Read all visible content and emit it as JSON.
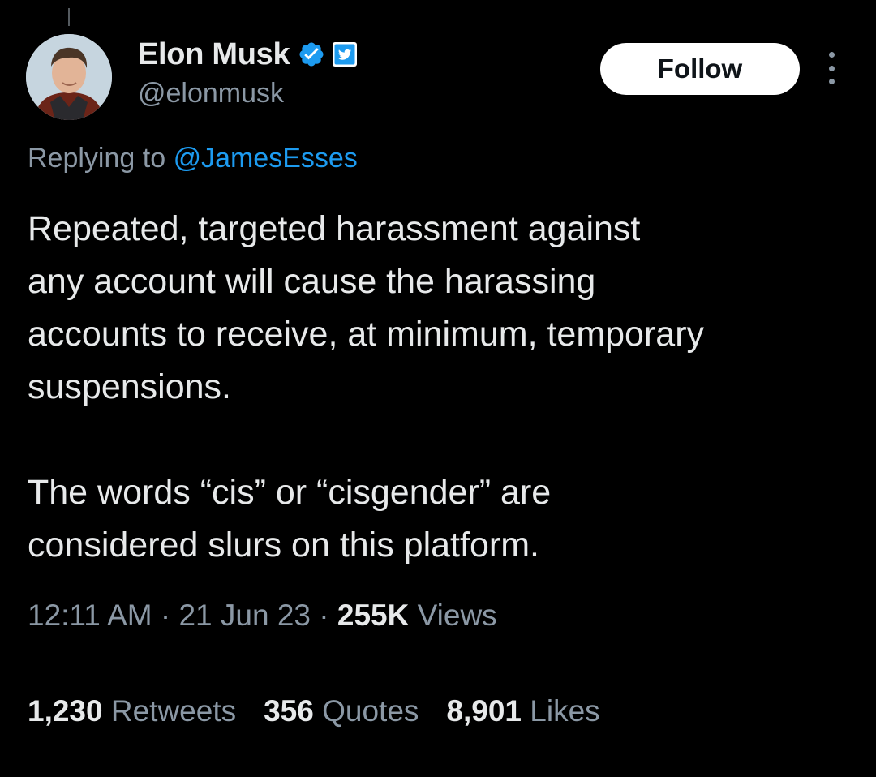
{
  "author": {
    "display_name": "Elon Musk",
    "handle": "@elonmusk",
    "verified_icon": "verified-badge-icon",
    "affiliate_icon": "twitter-bird-badge-icon",
    "verified_color": "#1d9bf0"
  },
  "header": {
    "follow_label": "Follow",
    "more_icon": "more-vertical-icon"
  },
  "reply": {
    "prefix": "Replying to",
    "mention": "@JamesEsses"
  },
  "tweet": {
    "paragraphs": [
      "Repeated, targeted harassment against\nany account will cause the harassing\naccounts to receive, at minimum, temporary\nsuspensions.",
      "The words “cis” or “cisgender” are\nconsidered slurs on this platform."
    ]
  },
  "meta": {
    "time": "12:11 AM",
    "separator": "·",
    "date": "21 Jun 23",
    "views_count": "255K",
    "views_label": "Views"
  },
  "stats": {
    "retweets_count": "1,230",
    "retweets_label": "Retweets",
    "quotes_count": "356",
    "quotes_label": "Quotes",
    "likes_count": "8,901",
    "likes_label": "Likes"
  },
  "colors": {
    "background": "#000000",
    "primary_text": "#e7e9ea",
    "secondary_text": "#8b98a5",
    "link": "#1d9bf0",
    "divider": "#2f3336"
  }
}
